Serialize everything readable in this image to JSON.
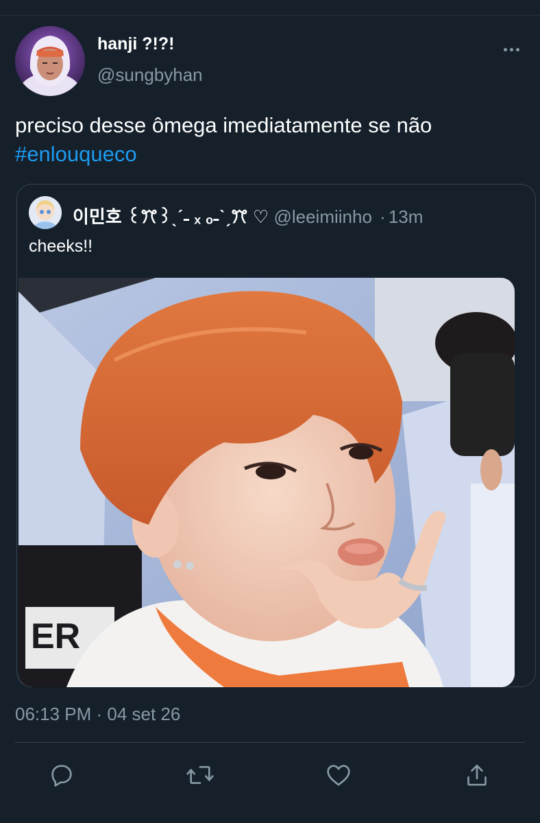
{
  "tweet": {
    "display_name": "hanji ?!?!",
    "handle": "@sungbyhan",
    "text": "preciso desse ômega imediatamente se não",
    "hashtag": "#enlouqueco",
    "timestamp": "06:13 PM · 04 set 26"
  },
  "quoted_tweet": {
    "display_name": "이민호 ꒰ꔫ꒱ˎˊ˗ ₓ ₒ˗ˋˏꔫ ♡",
    "handle": "@leeimiinho",
    "separator": "·",
    "time_ago": "13m",
    "text": "cheeks!!"
  },
  "actions": {
    "reply_icon": "reply-icon",
    "retweet_icon": "retweet-icon",
    "like_icon": "heart-icon",
    "share_icon": "share-icon"
  },
  "colors": {
    "background": "#15202b",
    "secondary_text": "#8899a6",
    "link": "#1d9bf0",
    "border": "#38444d"
  }
}
